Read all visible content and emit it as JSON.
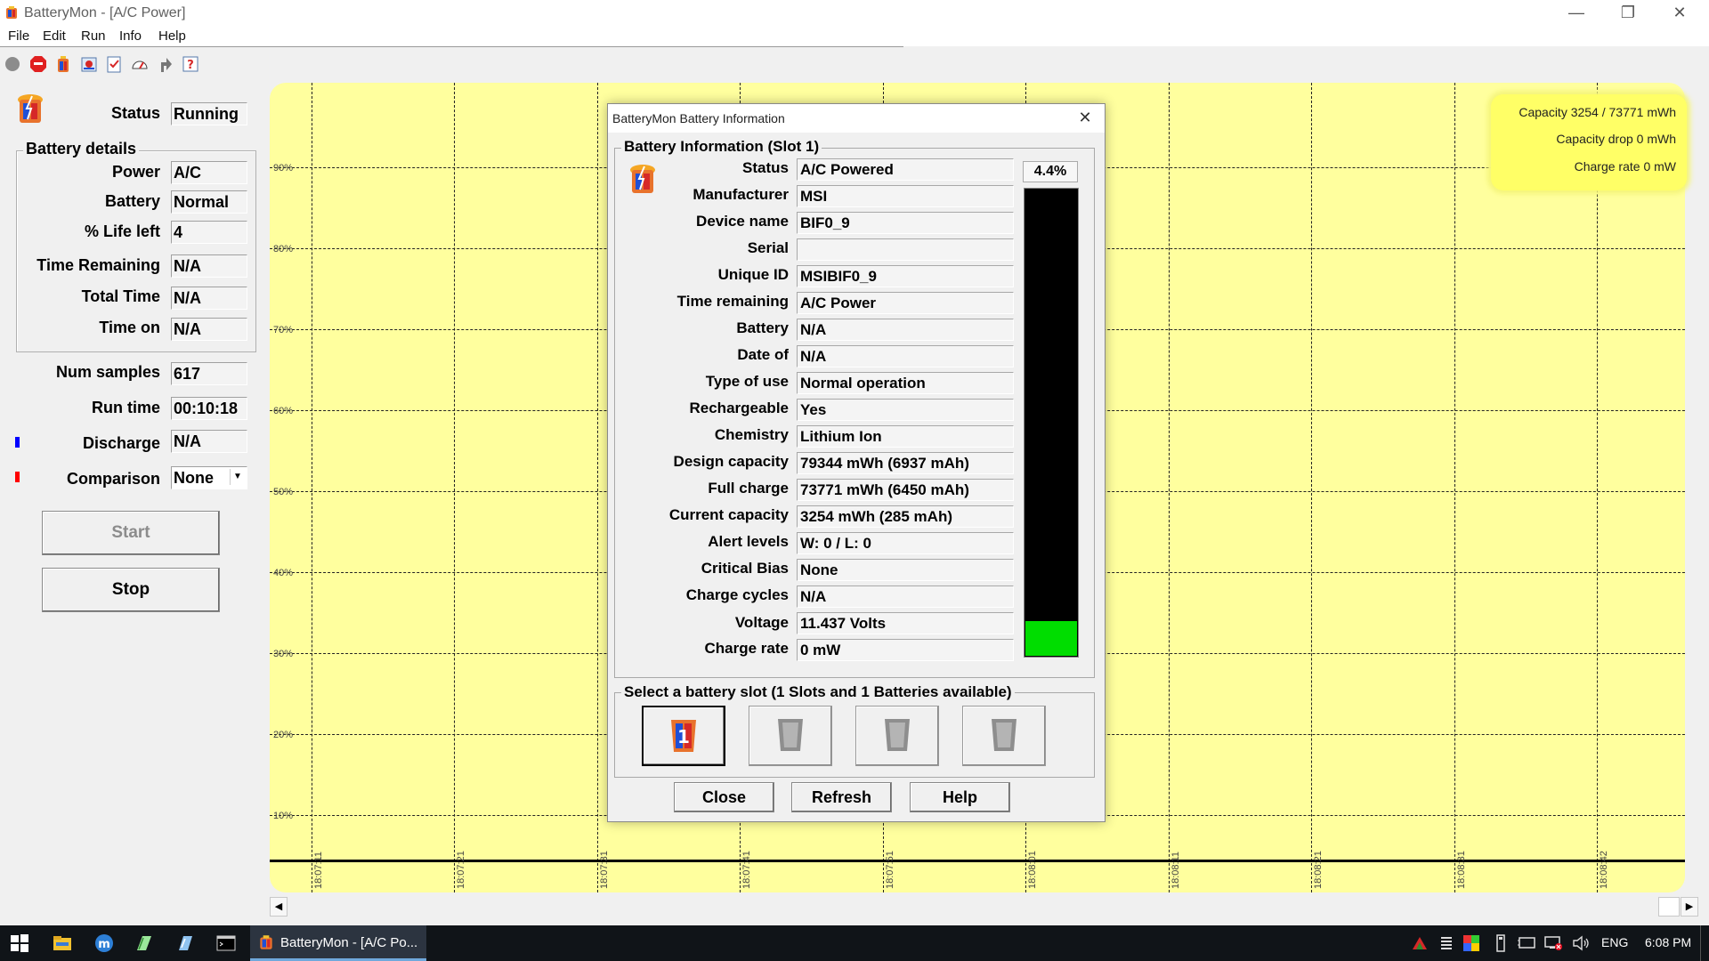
{
  "window": {
    "title": "BatteryMon - [A/C Power]",
    "app_icon": "batterymon-icon"
  },
  "menu": [
    "File",
    "Edit",
    "Run",
    "Info",
    "Help"
  ],
  "toolbar": {
    "icons": [
      "record-icon",
      "stop-icon",
      "battery-icon",
      "settings-icon",
      "checklist-icon",
      "gauge-icon",
      "pointer-icon",
      "help-icon"
    ]
  },
  "left_panel": {
    "status_label": "Status",
    "status_value": "Running",
    "battery_details_title": "Battery details",
    "fields": [
      {
        "label": "Power",
        "value": "A/C"
      },
      {
        "label": "Battery",
        "value": "Normal"
      },
      {
        "label": "% Life left",
        "value": "4"
      },
      {
        "label": "Time Remaining",
        "value": "N/A"
      },
      {
        "label": "Total Time",
        "value": "N/A"
      },
      {
        "label": "Time on",
        "value": "N/A"
      }
    ],
    "num_samples_label": "Num samples",
    "num_samples_value": "617",
    "run_time_label": "Run time",
    "run_time_value": "00:10:18",
    "discharge_label": "Discharge",
    "discharge_value": "N/A",
    "comparison_label": "Comparison",
    "comparison_value": "None",
    "start_label": "Start",
    "stop_label": "Stop",
    "colors": {
      "discharge_marker": "#0000ff",
      "comparison_marker": "#ff0000"
    }
  },
  "chart": {
    "y_ticks": [
      "90%",
      "80%",
      "70%",
      "60%",
      "50%",
      "40%",
      "30%",
      "20%",
      "10%"
    ],
    "x_ticks": [
      "18:07:11",
      "18:07:21",
      "18:07:31",
      "18:07:41",
      "18:07:51",
      "18:08:01",
      "18:08:11",
      "18:08:21",
      "18:08:31",
      "18:08:42"
    ],
    "info_box": {
      "capacity": "Capacity 3254 / 73771 mWh",
      "capacity_drop": "Capacity drop 0 mWh",
      "charge_rate": "Charge rate 0 mW"
    },
    "colors": {
      "background": "#ffff9e",
      "info_box": "#ffff66"
    }
  },
  "dialog": {
    "title": "BatteryMon Battery Information",
    "group_title": "Battery Information (Slot 1)",
    "rows": [
      {
        "label": "Status",
        "value": "A/C Powered"
      },
      {
        "label": "Manufacturer",
        "value": "MSI"
      },
      {
        "label": "Device name",
        "value": "BIF0_9"
      },
      {
        "label": "Serial",
        "value": ""
      },
      {
        "label": "Unique ID",
        "value": "MSIBIF0_9"
      },
      {
        "label": "Time remaining",
        "value": "A/C Power"
      },
      {
        "label": "Battery",
        "value": "N/A"
      },
      {
        "label": "Date of",
        "value": "N/A"
      },
      {
        "label": "Type of use",
        "value": "Normal operation"
      },
      {
        "label": "Rechargeable",
        "value": "Yes"
      },
      {
        "label": "Chemistry",
        "value": "Lithium Ion"
      },
      {
        "label": "Design capacity",
        "value": "79344 mWh (6937 mAh)"
      },
      {
        "label": "Full charge",
        "value": "73771 mWh (6450 mAh)"
      },
      {
        "label": "Current capacity",
        "value": "3254 mWh (285 mAh)"
      },
      {
        "label": "Alert levels",
        "value": "W: 0 / L: 0"
      },
      {
        "label": "Critical Bias",
        "value": "None"
      },
      {
        "label": "Charge cycles",
        "value": "N/A"
      },
      {
        "label": "Voltage",
        "value": "11.437 Volts"
      },
      {
        "label": "Charge rate",
        "value": "0 mW"
      }
    ],
    "charge_percent_label": "4.4%",
    "charge_fraction": 0.044,
    "slot_group_title": "Select a battery slot (1 Slots and 1 Batteries available)",
    "slots": [
      {
        "name": "slot-1",
        "selected": true
      },
      {
        "name": "slot-2",
        "selected": false
      },
      {
        "name": "slot-3",
        "selected": false
      },
      {
        "name": "slot-4",
        "selected": false
      }
    ],
    "buttons": {
      "close": "Close",
      "refresh": "Refresh",
      "help": "Help"
    },
    "colors": {
      "level_fill": "#00dd00",
      "level_bg": "#000000"
    }
  },
  "taskbar": {
    "active_task": "BatteryMon - [A/C Po...",
    "language": "ENG",
    "time": "6:08 PM",
    "pinned_icons": [
      "windows-start-icon",
      "file-explorer-icon",
      "app-blue-icon",
      "notes-icon",
      "editor-icon",
      "terminal-icon"
    ]
  }
}
